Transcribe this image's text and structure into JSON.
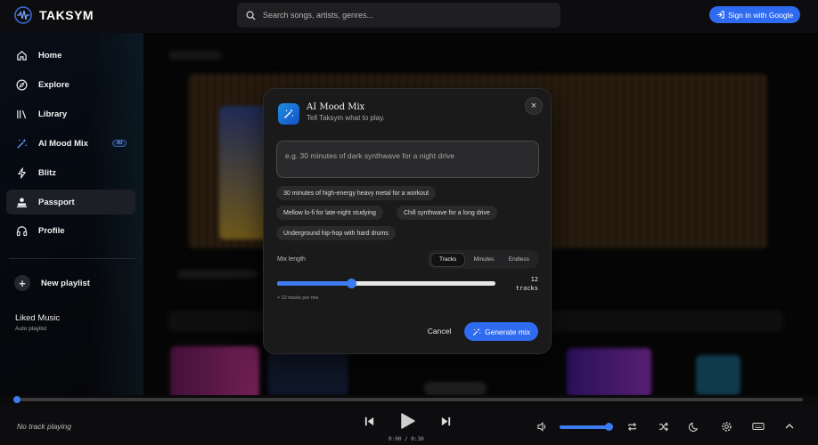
{
  "app": {
    "name": "TAKSYM"
  },
  "search": {
    "placeholder": "Search songs, artists, genres..."
  },
  "header": {
    "signin_label": "Sign in with Google"
  },
  "sidebar": {
    "items": [
      {
        "label": "Home",
        "icon": "home-icon"
      },
      {
        "label": "Explore",
        "icon": "compass-icon"
      },
      {
        "label": "Library",
        "icon": "library-icon"
      },
      {
        "label": "AI Mood Mix",
        "icon": "magic-wand-icon",
        "badge": "AI"
      },
      {
        "label": "Blitz",
        "icon": "lightning-icon"
      },
      {
        "label": "Passport",
        "icon": "passport-icon",
        "active": true
      },
      {
        "label": "Profile",
        "icon": "headphones-icon"
      }
    ],
    "new_playlist_label": "New playlist",
    "liked": {
      "title": "Liked Music",
      "subtitle": "Auto playlist"
    }
  },
  "modal": {
    "title": "AI Mood Mix",
    "subtitle": "Tell Taksym what to play.",
    "prompt_placeholder": "e.g. 30 minutes of dark synthwave for a night drive",
    "suggestions": [
      "30 minutes of high-energy heavy metal for a workout",
      "Mellow lo-fi for late-night studying",
      "Chill synthwave for a long drive",
      "Underground hip-hop with hard drums"
    ],
    "mix_length_label": "Mix length",
    "modes": [
      "Tracks",
      "Minutes",
      "Endless"
    ],
    "selected_mode": "Tracks",
    "slider_value": 12,
    "slider_fraction": 0.34,
    "count_value": "12",
    "count_unit": "tracks",
    "hint": "≈ 12 tracks per mix",
    "cancel_label": "Cancel",
    "generate_label": "Generate mix"
  },
  "player": {
    "now_playing": "No track playing",
    "time": "0:00 / 0:30",
    "volume_fraction": 1.0
  },
  "colors": {
    "accent": "#2f6bf0",
    "background": "#0d0d0f",
    "modal": "#1a1a1b"
  }
}
